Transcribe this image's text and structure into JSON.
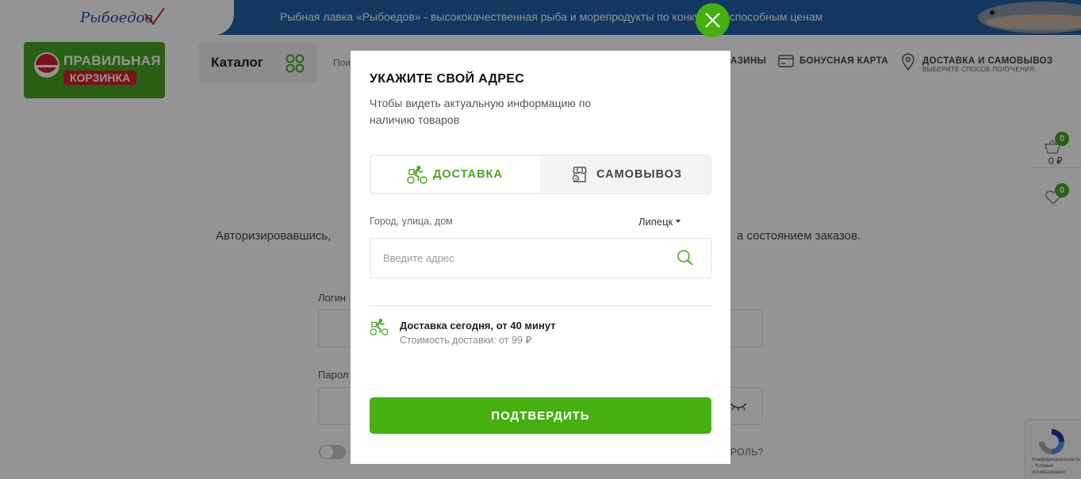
{
  "banner": {
    "text": "Рыбная лавка «Рыбоедов» - высококачественная рыба и морепродукты по конкурентоспособным ценам"
  },
  "top_logo": {
    "text": "Рыбоедов"
  },
  "logo": {
    "line1": "ПРАВИЛЬНАЯ",
    "line2": "КОРЗИНКА"
  },
  "header": {
    "catalog_label": "Каталог",
    "search_stub": "Пои",
    "nav_shops_partial": "АЗИНЫ",
    "nav_bonus": "БОНУСНАЯ КАРТА",
    "nav_delivery": "ДОСТАВКА И САМОВЫВОЗ",
    "nav_delivery_sub": "ВЫБЕРИТЕ СПОСОБ ПОЛУЧЕНИЯ"
  },
  "side": {
    "cart_count": "0",
    "cart_sum": "0 ₽",
    "fav_count": "0"
  },
  "background": {
    "auth_left": "Авторизировавшись,",
    "auth_right": "а состоянием заказов.",
    "login_label": "Логин",
    "password_label": "Парол",
    "forgot": "РОЛЬ?",
    "recaptcha": "Конфиденциальность - Условия использования"
  },
  "modal": {
    "title": "УКАЖИТЕ СВОЙ АДРЕС",
    "subtitle": "Чтобы видеть актуальную информацию по наличию товаров",
    "tabs": {
      "delivery": "ДОСТАВКА",
      "pickup": "САМОВЫВОЗ"
    },
    "address_label": "Город, улица, дом",
    "city": "Липецк",
    "address_placeholder": "Введите адрес",
    "delivery_info_title": "Доставка сегодня, от 40 минут",
    "delivery_info_cost": "Стоимость доставки: от 99 ₽",
    "confirm": "ПОДТВЕРДИТЬ"
  },
  "colors": {
    "accent_green": "#46b011",
    "banner_blue": "#1f5fa8",
    "logo_red": "#d4202c"
  },
  "icons": [
    "close-icon",
    "courier-bike-icon",
    "store-icon",
    "search-icon",
    "cart-icon",
    "heart-icon",
    "grid-icon",
    "card-icon",
    "map-pin-icon",
    "eye-closed-icon"
  ]
}
